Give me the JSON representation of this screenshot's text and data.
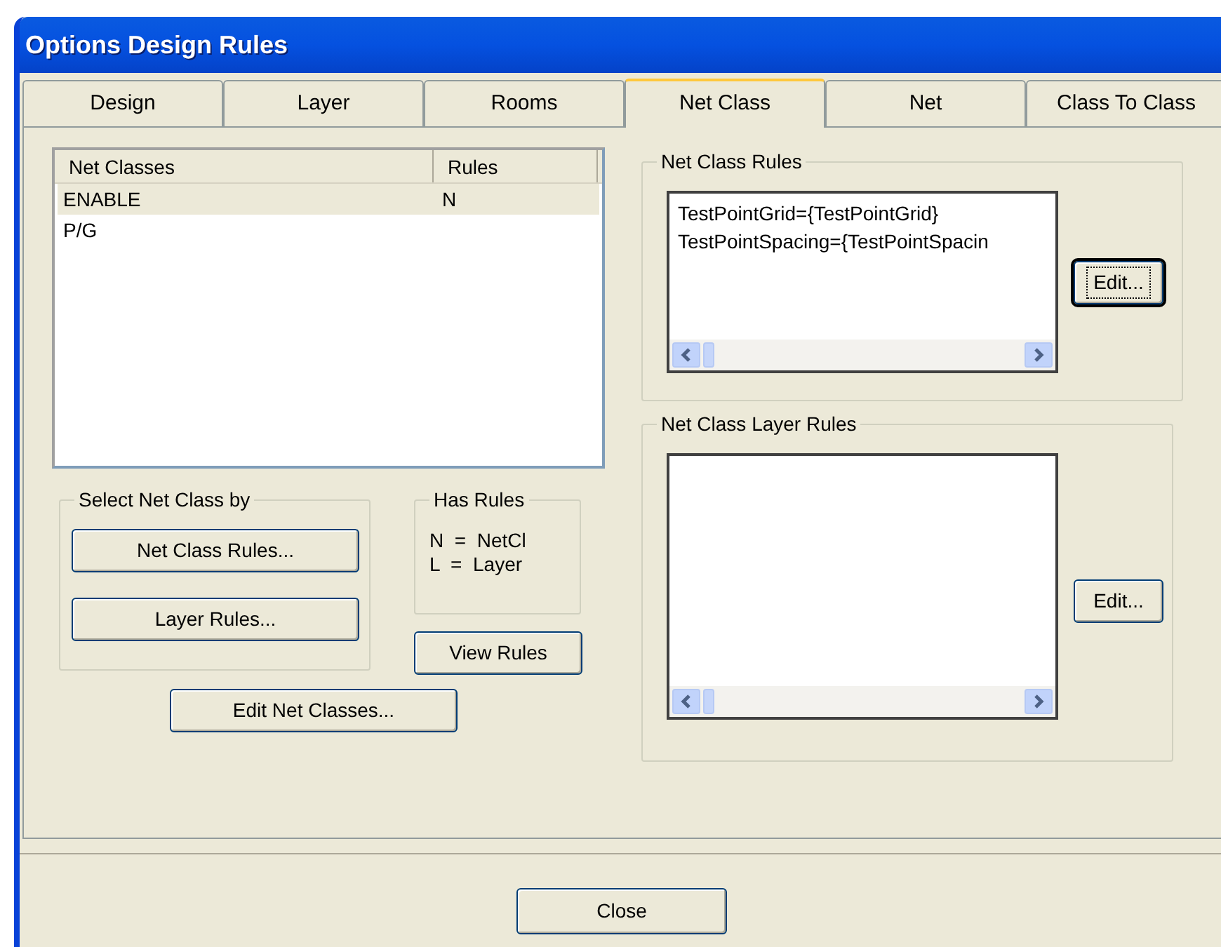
{
  "window": {
    "title": "Options Design Rules"
  },
  "tabs": [
    {
      "label": "Design",
      "selected": false
    },
    {
      "label": "Layer",
      "selected": false
    },
    {
      "label": "Rooms",
      "selected": false
    },
    {
      "label": "Net Class",
      "selected": true
    },
    {
      "label": "Net",
      "selected": false
    },
    {
      "label": "Class To Class",
      "selected": false
    }
  ],
  "net_class_list": {
    "columns": [
      "Net Classes",
      "Rules"
    ],
    "rows": [
      {
        "cells": [
          "ENABLE",
          "N"
        ],
        "selected": true
      },
      {
        "cells": [
          "P/G",
          ""
        ],
        "selected": false
      }
    ]
  },
  "select_group": {
    "title": "Select Net Class by",
    "buttons": [
      "Net Class Rules...",
      "Layer Rules..."
    ]
  },
  "has_rules": {
    "title": "Has Rules",
    "lines": [
      "N  =  NetCl",
      "L  =  Layer"
    ]
  },
  "view_rules_button": "View Rules",
  "edit_net_classes_button": "Edit Net Classes...",
  "net_class_rules": {
    "title": "Net Class Rules",
    "lines": [
      "TestPointGrid={TestPointGrid}",
      "TestPointSpacing={TestPointSpacin"
    ],
    "button": "Edit...",
    "button_focused": true
  },
  "net_class_layer_rules": {
    "title": "Net Class Layer Rules",
    "button": "Edit...",
    "button_focused": false
  },
  "close_button": "Close"
}
